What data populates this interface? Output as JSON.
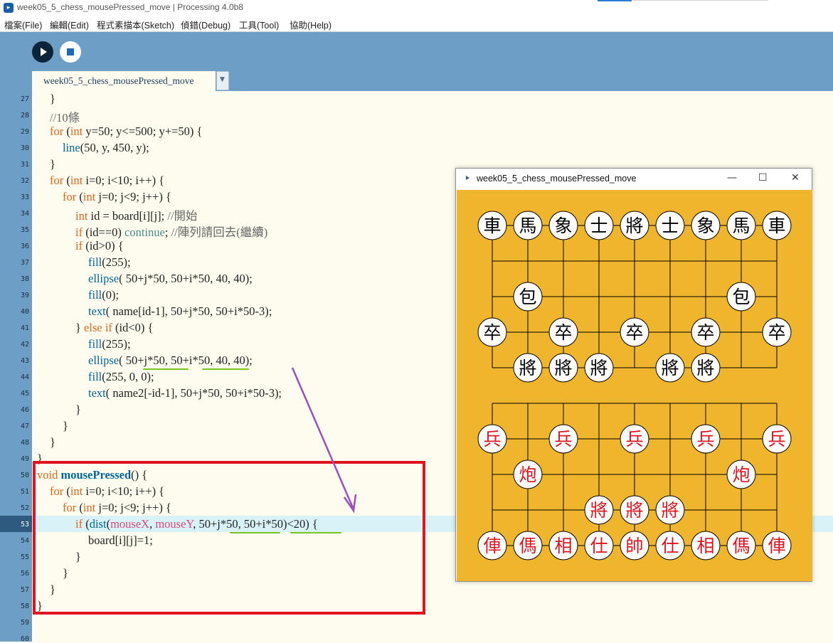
{
  "window": {
    "title": "week05_5_chess_mousePressed_move | Processing 4.0b8"
  },
  "menu": [
    "檔案(File)",
    "編輯(Edit)",
    "程式素描本(Sketch)",
    "偵錯(Debug)",
    "工具(Tool)",
    "協助(Help)"
  ],
  "toolbar": {
    "run": "Run",
    "stop": "Stop"
  },
  "tab": {
    "label": "week05_5_chess_mousePressed_move",
    "dropdown": "▼"
  },
  "editor": {
    "first_line": 27,
    "last_line": 60,
    "current_line": 53,
    "lines": [
      {
        "n": 27,
        "indent": 1,
        "tokens": [
          {
            "t": "}"
          }
        ]
      },
      {
        "n": 28,
        "indent": 1,
        "tokens": [
          {
            "t": "//10條",
            "c": "cm"
          }
        ]
      },
      {
        "n": 29,
        "indent": 1,
        "tokens": [
          {
            "t": "for",
            "c": "kw"
          },
          {
            "t": " ("
          },
          {
            "t": "int",
            "c": "kw"
          },
          {
            "t": " y=50; y<=500; y+=50) {"
          }
        ]
      },
      {
        "n": 30,
        "indent": 2,
        "tokens": [
          {
            "t": "line",
            "c": "fn"
          },
          {
            "t": "(50, y, 450, y);"
          }
        ]
      },
      {
        "n": 31,
        "indent": 1,
        "tokens": [
          {
            "t": "}"
          }
        ]
      },
      {
        "n": 32,
        "indent": 1,
        "tokens": [
          {
            "t": "for",
            "c": "kw"
          },
          {
            "t": " ("
          },
          {
            "t": "int",
            "c": "kw"
          },
          {
            "t": " i=0; i<10; i++) {"
          }
        ]
      },
      {
        "n": 33,
        "indent": 2,
        "tokens": [
          {
            "t": "for",
            "c": "kw"
          },
          {
            "t": " ("
          },
          {
            "t": "int",
            "c": "kw"
          },
          {
            "t": " j=0; j<9; j++) {"
          }
        ]
      },
      {
        "n": 34,
        "indent": 3,
        "tokens": [
          {
            "t": "int",
            "c": "kw"
          },
          {
            "t": " id = board[i][j]; "
          },
          {
            "t": "//開始",
            "c": "cm"
          }
        ]
      },
      {
        "n": 35,
        "indent": 3,
        "tokens": [
          {
            "t": "if",
            "c": "kw"
          },
          {
            "t": " (id==0) "
          },
          {
            "t": "continue",
            "c": "lv"
          },
          {
            "t": "; "
          },
          {
            "t": "//陣列請回去(繼續)",
            "c": "cm"
          }
        ]
      },
      {
        "n": 36,
        "indent": 3,
        "tokens": [
          {
            "t": "if",
            "c": "kw"
          },
          {
            "t": " (id>0) {"
          }
        ]
      },
      {
        "n": 37,
        "indent": 4,
        "tokens": [
          {
            "t": "fill",
            "c": "fn"
          },
          {
            "t": "(255);"
          }
        ]
      },
      {
        "n": 38,
        "indent": 4,
        "tokens": [
          {
            "t": "ellipse",
            "c": "fn"
          },
          {
            "t": "( 50+j*50, 50+i*50, 40, 40);"
          }
        ]
      },
      {
        "n": 39,
        "indent": 4,
        "tokens": [
          {
            "t": "fill",
            "c": "fn"
          },
          {
            "t": "(0);"
          }
        ]
      },
      {
        "n": 40,
        "indent": 4,
        "tokens": [
          {
            "t": "text",
            "c": "fn"
          },
          {
            "t": "( name[id-1], 50+j*50, 50+i*50-3);"
          }
        ]
      },
      {
        "n": 41,
        "indent": 3,
        "tokens": [
          {
            "t": "} "
          },
          {
            "t": "else",
            "c": "kw"
          },
          {
            "t": " "
          },
          {
            "t": "if",
            "c": "kw"
          },
          {
            "t": " (id<0) {"
          }
        ]
      },
      {
        "n": 42,
        "indent": 4,
        "tokens": [
          {
            "t": "fill",
            "c": "fn"
          },
          {
            "t": "(255);"
          }
        ]
      },
      {
        "n": 43,
        "indent": 4,
        "tokens": [
          {
            "t": "ellipse",
            "c": "fn"
          },
          {
            "t": "( 50+j*50, 50+i*50, 40, 40);"
          }
        ]
      },
      {
        "n": 44,
        "indent": 4,
        "tokens": [
          {
            "t": "fill",
            "c": "fn"
          },
          {
            "t": "(255, 0, 0);"
          }
        ]
      },
      {
        "n": 45,
        "indent": 4,
        "tokens": [
          {
            "t": "text",
            "c": "fn"
          },
          {
            "t": "( name2[-id-1], 50+j*50, 50+i*50-3);"
          }
        ]
      },
      {
        "n": 46,
        "indent": 3,
        "tokens": [
          {
            "t": "}"
          }
        ]
      },
      {
        "n": 47,
        "indent": 2,
        "tokens": [
          {
            "t": "}"
          }
        ]
      },
      {
        "n": 48,
        "indent": 1,
        "tokens": [
          {
            "t": "}"
          }
        ]
      },
      {
        "n": 49,
        "indent": 0,
        "tokens": [
          {
            "t": "}"
          }
        ]
      },
      {
        "n": 50,
        "indent": 0,
        "tokens": [
          {
            "t": "void",
            "c": "kw"
          },
          {
            "t": " "
          },
          {
            "t": "mousePressed",
            "c": "fnb"
          },
          {
            "t": "() {"
          }
        ]
      },
      {
        "n": 51,
        "indent": 1,
        "tokens": [
          {
            "t": "for",
            "c": "kw"
          },
          {
            "t": " ("
          },
          {
            "t": "int",
            "c": "kw"
          },
          {
            "t": " i=0; i<10; i++) {"
          }
        ]
      },
      {
        "n": 52,
        "indent": 2,
        "tokens": [
          {
            "t": "for",
            "c": "kw"
          },
          {
            "t": " ("
          },
          {
            "t": "int",
            "c": "kw"
          },
          {
            "t": " j=0; j<9; j++) {"
          }
        ]
      },
      {
        "n": 53,
        "indent": 3,
        "tokens": [
          {
            "t": "if",
            "c": "kw"
          },
          {
            "t": " ("
          },
          {
            "t": "dist",
            "c": "fn"
          },
          {
            "t": "("
          },
          {
            "t": "mouseX",
            "c": "mv"
          },
          {
            "t": ", "
          },
          {
            "t": "mouseY",
            "c": "mv"
          },
          {
            "t": ", 50+j*50, 50+i*50)<20) {"
          }
        ]
      },
      {
        "n": 54,
        "indent": 4,
        "tokens": [
          {
            "t": "board[i][j]=1;"
          }
        ]
      },
      {
        "n": 55,
        "indent": 3,
        "tokens": [
          {
            "t": "}"
          }
        ]
      },
      {
        "n": 56,
        "indent": 2,
        "tokens": [
          {
            "t": "}"
          }
        ]
      },
      {
        "n": 57,
        "indent": 1,
        "tokens": [
          {
            "t": "}"
          }
        ]
      },
      {
        "n": 58,
        "indent": 0,
        "tokens": [
          {
            "t": "}"
          }
        ]
      },
      {
        "n": 59,
        "indent": 0,
        "tokens": []
      },
      {
        "n": 60,
        "indent": 0,
        "tokens": []
      }
    ]
  },
  "annotations": {
    "highlight_color": "#7ac420",
    "box_color": "#e0141c",
    "arrow_color": "#9b4fc0"
  },
  "sketch": {
    "title": "week05_5_chess_mousePressed_move",
    "controls": [
      "—",
      "☐",
      "✕"
    ],
    "board_color": "#efb52c",
    "black_text_color": "#000000",
    "red_text_color": "#e0141c",
    "black_pieces": [
      [
        "車",
        "馬",
        "象",
        "士",
        "將",
        "士",
        "象",
        "馬",
        "車"
      ],
      [
        "",
        "",
        "",
        "",
        "",
        "",
        "",
        "",
        ""
      ],
      [
        "",
        "包",
        "",
        "",
        "",
        "",
        "",
        "包",
        ""
      ],
      [
        "卒",
        "",
        "卒",
        "",
        "卒",
        "",
        "卒",
        "",
        "卒"
      ],
      [
        "",
        "將",
        "將",
        "將",
        "",
        "將",
        "將",
        "",
        ""
      ]
    ],
    "red_pieces": [
      [
        "兵",
        "",
        "兵",
        "",
        "兵",
        "",
        "兵",
        "",
        "兵"
      ],
      [
        "",
        "炮",
        "",
        "",
        "",
        "",
        "",
        "炮",
        ""
      ],
      [
        "",
        "",
        "",
        "將",
        "將",
        "將",
        "",
        "",
        ""
      ],
      [
        "俥",
        "傌",
        "相",
        "仕",
        "帥",
        "仕",
        "相",
        "傌",
        "俥"
      ]
    ]
  }
}
